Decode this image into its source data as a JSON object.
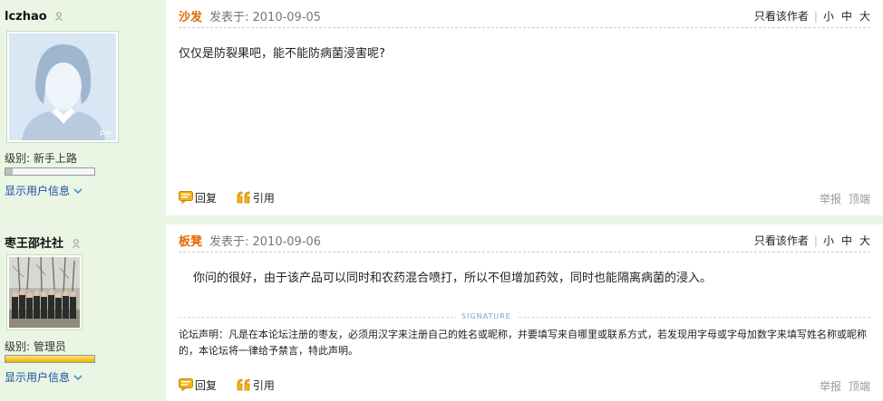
{
  "posts": [
    {
      "username": "lczhao",
      "level": "级别: 新手上路",
      "level_progress": 0.08,
      "show_info": "显示用户信息",
      "avatar_label": "pw",
      "floor": "沙发",
      "posted": "发表于: 2010-09-05",
      "only_author": "只看该作者",
      "size_small": "小",
      "size_medium": "中",
      "size_large": "大",
      "content": "仅仅是防裂果吧，能不能防病菌浸害呢?",
      "reply": "回复",
      "quote": "引用",
      "report": "举报",
      "top": "顶端"
    },
    {
      "username": "枣王邵社社",
      "level": "级别: 管理员",
      "level_progress": 1.0,
      "show_info": "显示用户信息",
      "floor": "板凳",
      "posted": "发表于: 2010-09-06",
      "only_author": "只看该作者",
      "size_small": "小",
      "size_medium": "中",
      "size_large": "大",
      "content": "你问的很好，由于该产品可以同时和农药混合喷打，所以不但增加药效，同时也能隔离病菌的浸入。",
      "signature_tag": "SIGNATURE",
      "notice": "论坛声明：凡是在本论坛注册的枣友，必须用汉字来注册自己的姓名或昵称，并要填写来自哪里或联系方式，若发现用字母或字母加数字来填写姓名称或昵称的，本论坛将一律给予禁言，特此声明。",
      "reply": "回复",
      "quote": "引用",
      "report": "举报",
      "top": "顶端"
    }
  ],
  "colors": {
    "background": "#eaf5e4",
    "floor": "#e06a00",
    "link": "#1a4fa0",
    "gold": "#e7b400"
  },
  "icons": [
    "user-gender-icon",
    "chevron-down-icon",
    "reply-icon",
    "quote-icon"
  ]
}
